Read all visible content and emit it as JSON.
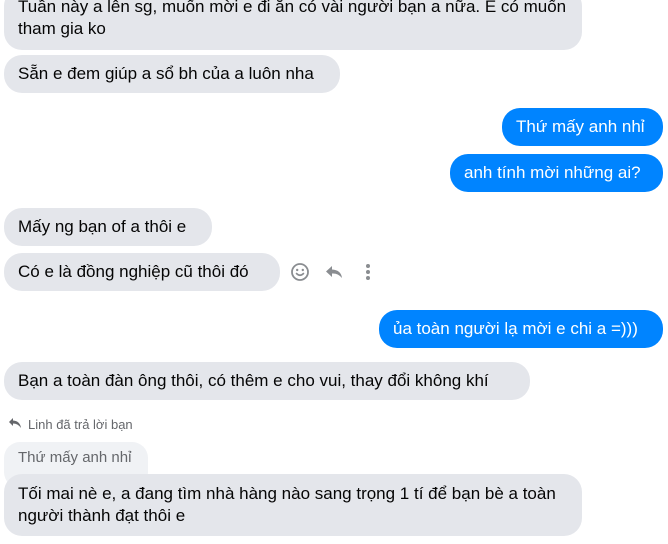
{
  "messages": [
    {
      "text": "Tuần này a lên sg, muốn mời e đi ăn có vài người bạn a nữa. E có muốn tham gia ko"
    },
    {
      "text": "Sẵn e đem giúp a sổ bh của a luôn nha"
    },
    {
      "text": "Thứ mấy anh nhỉ"
    },
    {
      "text": "anh tính mời những ai?"
    },
    {
      "text": "Mấy ng bạn of a thôi e"
    },
    {
      "text": "Có e là đồng nghiệp cũ thôi đó"
    },
    {
      "text": "ủa toàn người lạ mời e chi a =)))"
    },
    {
      "text": "Bạn a toàn đàn ông thôi, có thêm e cho vui, thay đổi không khí"
    },
    {
      "text": "Tối mai nè e, a đang tìm nhà hàng nào sang trọng 1 tí để bạn bè a toàn người thành đạt thôi e"
    }
  ],
  "reply": {
    "note": "Linh đã trả lời bạn",
    "quoted": "Thứ mấy anh nhỉ"
  },
  "actions": {
    "react": "smiley-icon",
    "reply": "reply-icon",
    "more": "more-icon"
  },
  "colors": {
    "outgoing": "#0084ff",
    "incoming": "#e4e6eb",
    "quoted": "#f0f2f5",
    "muted": "#65676b"
  }
}
